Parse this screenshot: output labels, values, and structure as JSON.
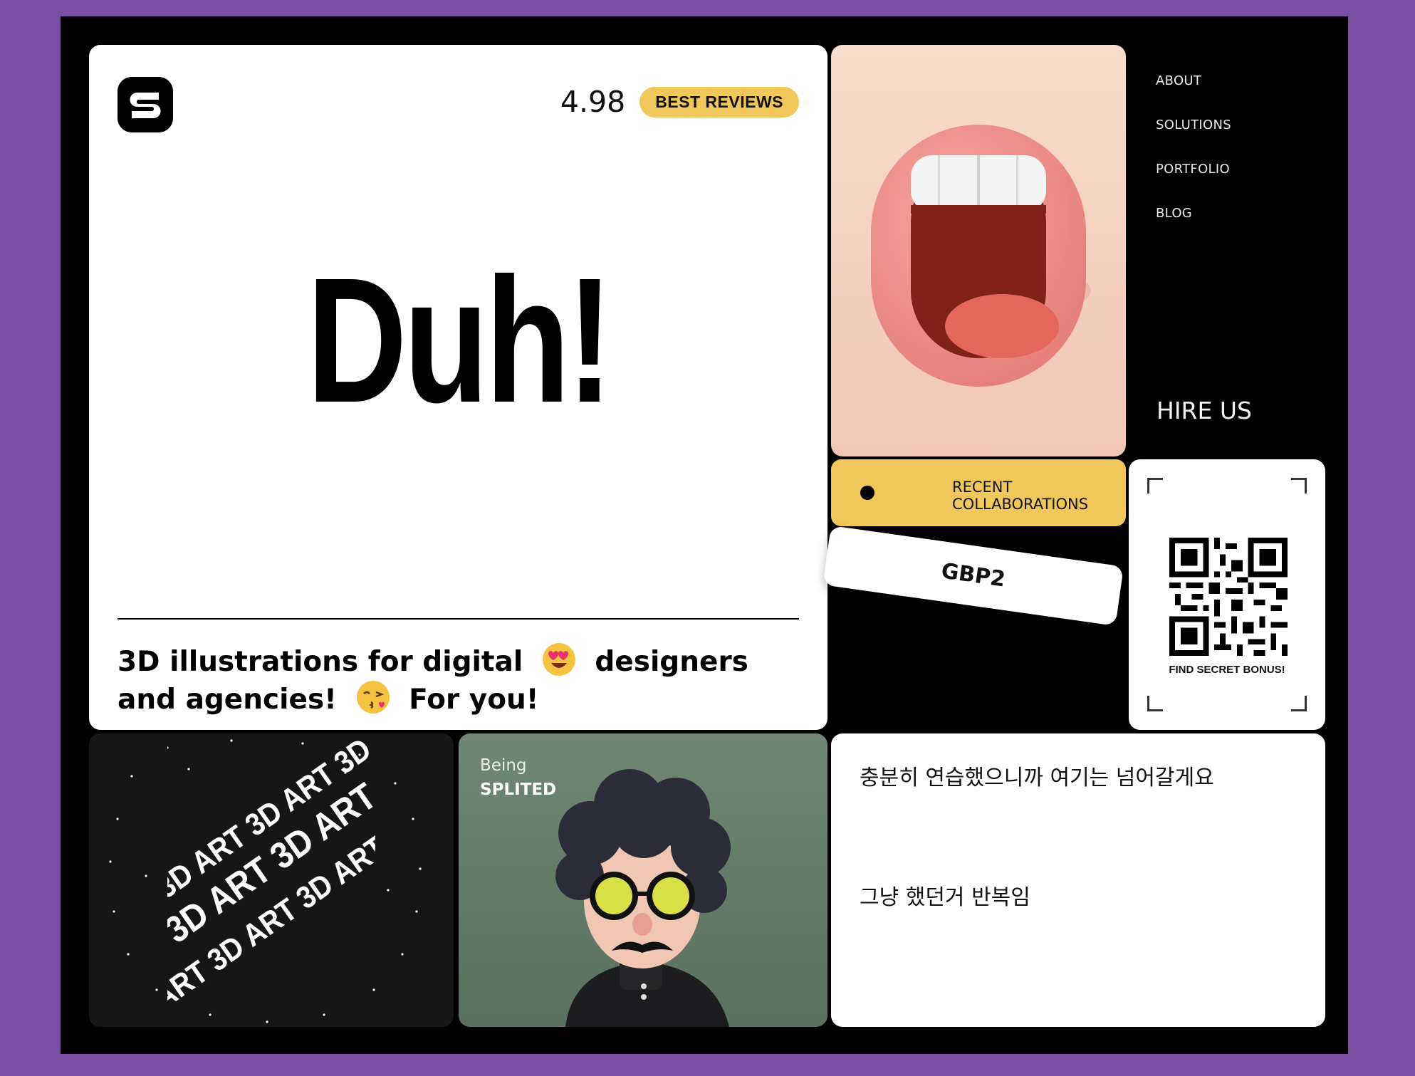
{
  "hero": {
    "rating": "4.98",
    "badge": "BEST REVIEWS",
    "headline": "Duh!",
    "tagline_part1": "3D illustrations for digital",
    "tagline_part2": "designers and agencies!",
    "tagline_part3": "For you!"
  },
  "nav": {
    "items": [
      "ABOUT",
      "SOLUTIONS",
      "PORTFOLIO",
      "BLOG"
    ],
    "hire": "HIRE US"
  },
  "collab": {
    "line1": "RECENT",
    "line2": "COLLABORATIONS",
    "tag": "GBP2"
  },
  "qr": {
    "caption": "FIND SECRET BONUS!"
  },
  "character_card": {
    "line1": "Being",
    "line2": "SPLITED"
  },
  "sphere_card": {
    "ring_text": "ART 3D ART 3D ART 3D"
  },
  "korean_card": {
    "line1": "충분히 연습했으니까 여기는 넘어갈게요",
    "line2": "그냥 했던거 반복임"
  },
  "colors": {
    "background": "#7a4fa3",
    "frame": "#000000",
    "accent_yellow": "#f0c75a",
    "character_bg": "#637a69"
  },
  "icons": [
    "brand-logo-icon",
    "heart-eyes-emoji-icon",
    "kiss-emoji-icon",
    "qr-code-icon"
  ]
}
